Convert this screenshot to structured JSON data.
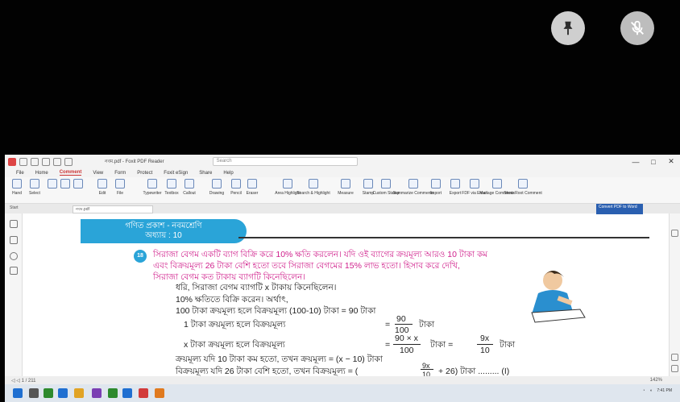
{
  "overlay": {
    "pin_icon": "pin-icon",
    "mic_off_icon": "mic-off-icon"
  },
  "window": {
    "title": "নবম.pdf - Foxit PDF Reader",
    "search_placeholder": "Search",
    "menu": [
      "File",
      "Home",
      "Comment",
      "View",
      "Form",
      "Protect",
      "Foxit eSign",
      "Share",
      "Help"
    ],
    "ribbon": [
      "Hand",
      "Select",
      "",
      "",
      "",
      "Edit",
      "File",
      "Typewriter",
      "Textbox",
      "Callout",
      "Drawing",
      "Pencil",
      "Eraser",
      "Area Highlight",
      "Search & Highlight",
      "Measure",
      "Stamp",
      "Custom Stamp",
      "Summarize Comments",
      "Import",
      "Export",
      "FDF via Email",
      "Manage Comments",
      "Show Root Comment"
    ],
    "tab_start": "Start",
    "doc_tab": "নবম.pdf",
    "cta": "Convert PDF to Word",
    "status_left": "◁ ◁  1 / 211",
    "status_right": "142%",
    "taskbar_time": "7:41 PM"
  },
  "page": {
    "banner_line1": "গণিত প্রকাশ - নবমশ্রেণি",
    "banner_line2": "অধ্যায় : 10",
    "q_number": "18",
    "problem_lines": [
      "সিরাজা বেগম একটি ব্যাগ বিক্রি করে 10% ক্ষতি করলেন। যদি ওই ব্যাগের ক্রয়মূল্য আরও 10 টাকা কম",
      "এবং বিক্রয়মূল্য 26 টাকা বেশি হতো তবে সিরাজা বেগমের 15% লাভ হতো। হিসাব করে দেখি,",
      "সিরাজা বেগম কত টাকায় ব্যাগটি কিনেছিলেন।"
    ],
    "l1": "ধরি, সিরাজা বেগম ব্যাগটি x টাকায় কিনেছিলেন।",
    "l2": "10% ক্ষতিতে বিক্রি করেন। অর্থাৎ,",
    "l3": "100 টাকা ক্রয়মূল্য হলে বিক্রয়মূল্য (100-10) টাকা = 90 টাকা",
    "l4a": "1   টাকা ক্রয়মূল্য হলে বিক্রয়মূল্য",
    "l4eq": "=",
    "l4n": "90",
    "l4d": "100",
    "l4u": "টাকা",
    "l5a": "x   টাকা ক্রয়মূল্য হলে বিক্রয়মূল্য",
    "l5eq": "=",
    "l5n": "90 × x",
    "l5d": "100",
    "l5m": "টাকা  =",
    "l5n2": "9x",
    "l5d2": "10",
    "l5u": "টাকা",
    "l6": "ক্রয়মূল্য যদি 10 টাকা কম হতো, তখন ক্রয়মূল্য = (x − 10) টাকা",
    "l7a": "বিক্রয়মূল্য যদি 26 টাকা বেশি হতো, তখন বিক্রয়মূল্য = (",
    "l7n": "9x",
    "l7d": "10",
    "l7b": "+ 26) টাকা ......... (I)"
  },
  "colors": {
    "accent": "#2aa4d8",
    "problem_text": "#d0208c"
  }
}
